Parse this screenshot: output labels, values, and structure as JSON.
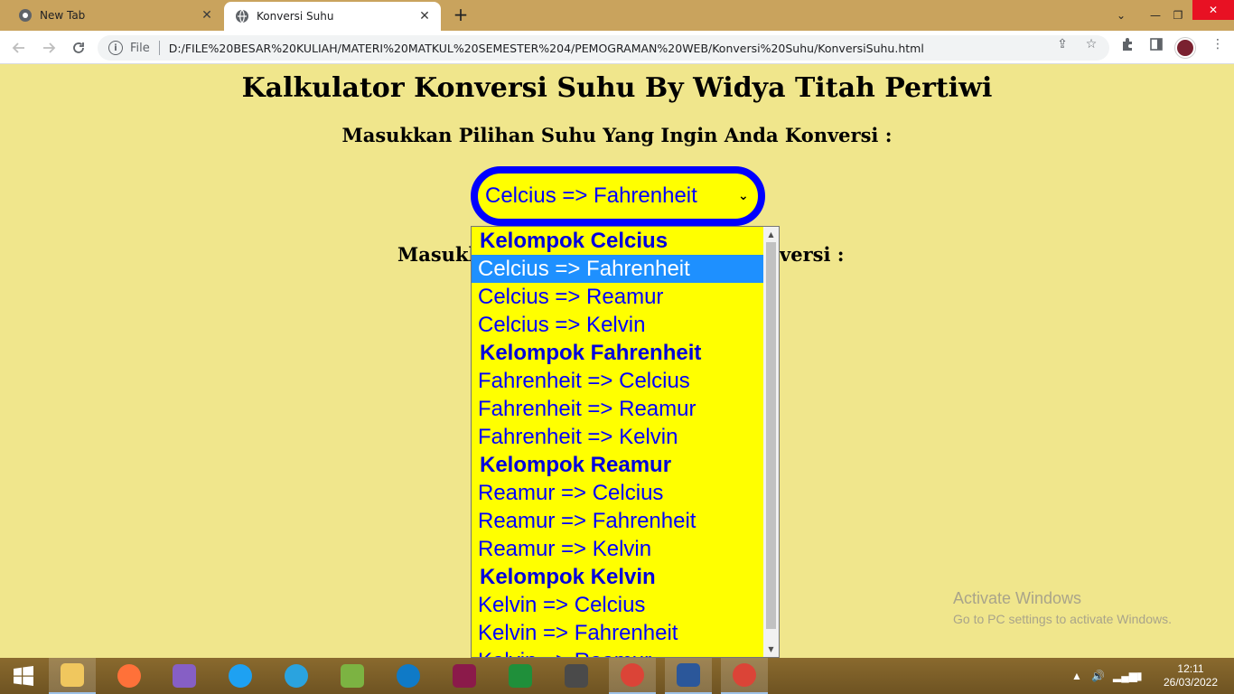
{
  "browser": {
    "tabs": [
      {
        "label": "New Tab",
        "icon": "chrome-icon",
        "active": false
      },
      {
        "label": "Konversi Suhu",
        "icon": "globe-icon",
        "active": true
      }
    ],
    "address": {
      "scheme_label": "File",
      "url": "D:/FILE%20BESAR%20KULIAH/MATERI%20MATKUL%20SEMESTER%204/PEMOGRAMAN%20WEB/Konversi%20Suhu/KonversiSuhu.html"
    }
  },
  "page": {
    "title": "Kalkulator Konversi Suhu By Widya Titah Pertiwi",
    "prompt_select": "Masukkan Pilihan Suhu Yang Ingin Anda Konversi :",
    "prompt_value_left": "Masukk",
    "prompt_value_right": "versi :",
    "select": {
      "value": "Celcius => Fahrenheit",
      "options": [
        {
          "label": "Kelompok Celcius",
          "group": true
        },
        {
          "label": "Celcius => Fahrenheit",
          "selected": true
        },
        {
          "label": "Celcius => Reamur"
        },
        {
          "label": "Celcius => Kelvin"
        },
        {
          "label": "Kelompok Fahrenheit",
          "group": true
        },
        {
          "label": "Fahrenheit => Celcius"
        },
        {
          "label": "Fahrenheit => Reamur"
        },
        {
          "label": "Fahrenheit => Kelvin"
        },
        {
          "label": "Kelompok Reamur",
          "group": true
        },
        {
          "label": "Reamur => Celcius"
        },
        {
          "label": "Reamur => Fahrenheit"
        },
        {
          "label": "Reamur => Kelvin"
        },
        {
          "label": "Kelompok Kelvin",
          "group": true
        },
        {
          "label": "Kelvin => Celcius"
        },
        {
          "label": "Kelvin => Fahrenheit"
        },
        {
          "label": "Kelvin => Reamur"
        }
      ]
    },
    "colors": {
      "background": "#f0e68c",
      "select_fill": "#ffff00",
      "select_border": "#0000ff",
      "option_text": "#0000ff",
      "selected_highlight": "#1e90ff"
    }
  },
  "watermark": {
    "line1": "Activate Windows",
    "line2": "Go to PC settings to activate Windows."
  },
  "taskbar": {
    "time": "12:11",
    "date": "26/03/2022"
  }
}
